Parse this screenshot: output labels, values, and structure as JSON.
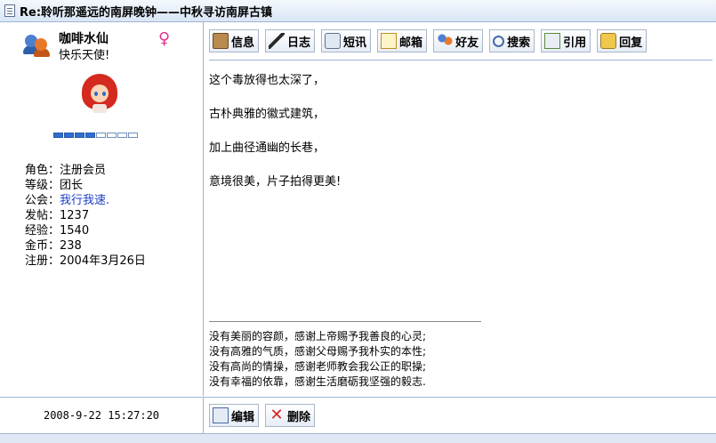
{
  "window": {
    "title": "Re:聆听那遥远的南屏晚钟——中秋寻访南屏古镇"
  },
  "user": {
    "name": "咖啡水仙",
    "title": "快乐天使!",
    "gender_symbol": "♀",
    "level_segments_filled": 4,
    "level_segments_total": 8,
    "info": [
      {
        "label": "角色：",
        "value": "注册会员"
      },
      {
        "label": "等级：",
        "value": "团长"
      },
      {
        "label": "公会：",
        "value": "我行我速."
      },
      {
        "label": "发帖：",
        "value": "1237"
      },
      {
        "label": "经验：",
        "value": "1540"
      },
      {
        "label": "金币：",
        "value": "238"
      },
      {
        "label": "注册：",
        "value": "2004年3月26日"
      }
    ]
  },
  "toolbar": {
    "info": "信息",
    "diary": "日志",
    "sms": "短讯",
    "mail": "邮箱",
    "friend": "好友",
    "search": "搜索",
    "quote": "引用",
    "reply": "回复"
  },
  "post": {
    "lines": [
      "这个毒放得也太深了，",
      "古朴典雅的徽式建筑，",
      "加上曲径通幽的长巷，",
      "意境很美，片子拍得更美!"
    ]
  },
  "signature": [
    "没有美丽的容颜，感谢上帝赐予我善良的心灵;",
    "没有高雅的气质，感谢父母赐予我朴实的本性;",
    "没有高尚的情操，感谢老师教会我公正的职操;",
    "没有幸福的依靠，感谢生活磨砺我坚强的毅志."
  ],
  "timestamp": "2008-9-22 15:27:20",
  "actions": {
    "edit": "编辑",
    "delete": "删除"
  }
}
